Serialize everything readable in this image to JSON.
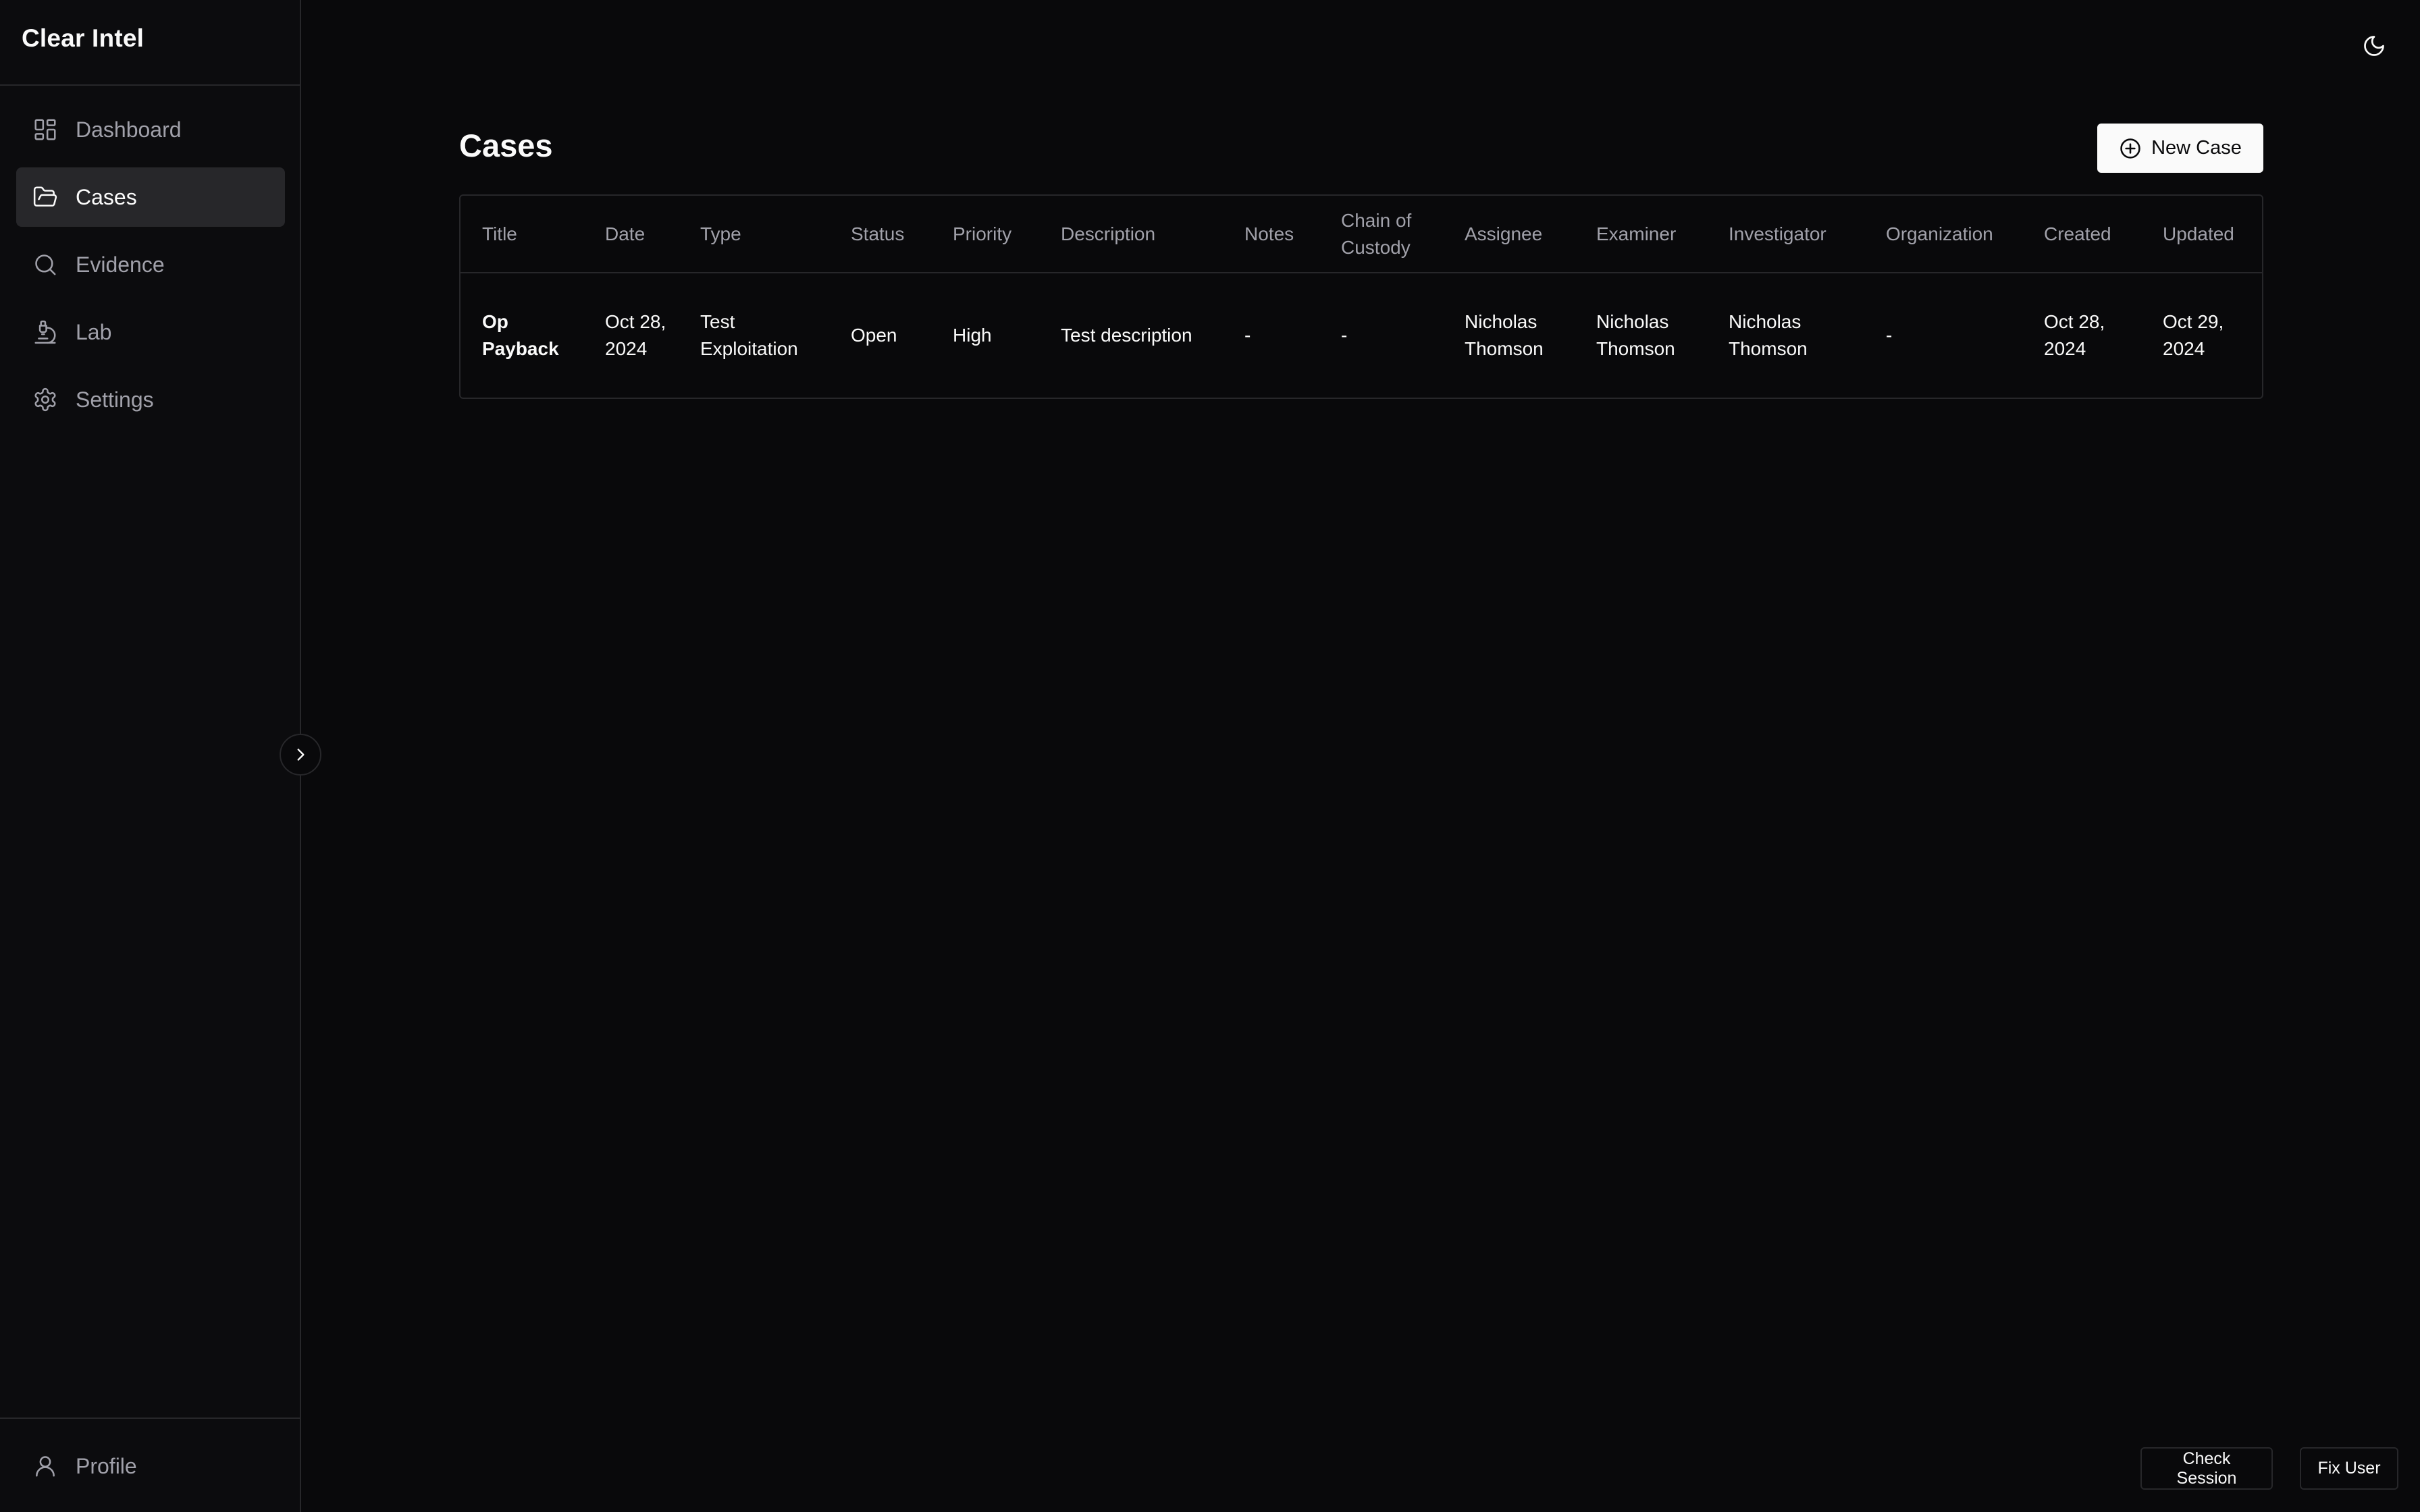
{
  "app": {
    "title": "Clear Intel"
  },
  "sidebar": {
    "items": [
      {
        "label": "Dashboard",
        "icon": "dashboard-icon",
        "active": false
      },
      {
        "label": "Cases",
        "icon": "folder-open-icon",
        "active": true
      },
      {
        "label": "Evidence",
        "icon": "search-icon",
        "active": false
      },
      {
        "label": "Lab",
        "icon": "microscope-icon",
        "active": false
      },
      {
        "label": "Settings",
        "icon": "gear-icon",
        "active": false
      }
    ],
    "profile_label": "Profile",
    "collapse_icon": "chevron-right-icon"
  },
  "header": {
    "theme_toggle_icon": "moon-icon"
  },
  "main": {
    "page_title": "Cases",
    "new_case_label": "New Case",
    "table": {
      "columns": [
        "Title",
        "Date",
        "Type",
        "Status",
        "Priority",
        "Description",
        "Notes",
        "Chain of Custody",
        "Assignee",
        "Examiner",
        "Investigator",
        "Organization",
        "Created",
        "Updated"
      ],
      "rows": [
        {
          "title": "Op Payback",
          "date": "Oct 28, 2024",
          "type": "Test Exploitation",
          "status": "Open",
          "priority": "High",
          "description": "Test description",
          "notes": "-",
          "chain_of_custody": "-",
          "assignee": "Nicholas Thomson",
          "examiner": "Nicholas Thomson",
          "investigator": "Nicholas Thomson",
          "organization": "-",
          "created": "Oct 28, 2024",
          "updated": "Oct 29, 2024"
        }
      ]
    }
  },
  "footer": {
    "check_session_label": "Check Session",
    "fix_user_label": "Fix User"
  },
  "colors": {
    "background": "#09090b",
    "sidebar": "#0c0c0e",
    "border": "#27272a",
    "active_item": "#27272a",
    "muted_text": "#a1a1aa",
    "text": "#fafafa",
    "primary_button": "#fafafa"
  }
}
